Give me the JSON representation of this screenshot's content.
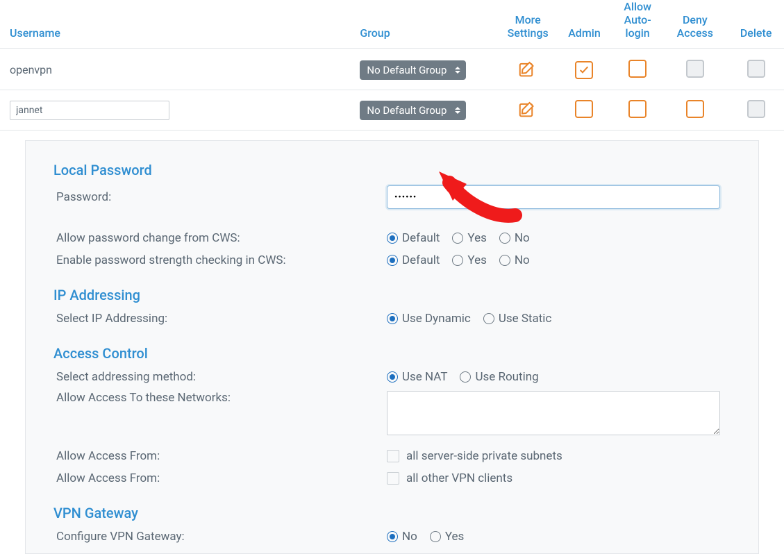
{
  "table": {
    "headers": {
      "username": "Username",
      "group": "Group",
      "more": "More Settings",
      "admin": "Admin",
      "autologin": "Allow Auto-login",
      "deny": "Deny Access",
      "delete": "Delete"
    },
    "rows": [
      {
        "username": "openvpn",
        "group": "No Default Group",
        "editable": false,
        "admin": true
      },
      {
        "username": "jannet",
        "group": "No Default Group",
        "editable": true,
        "admin": false
      }
    ]
  },
  "panel": {
    "local_password": {
      "title": "Local Password",
      "password_label": "Password:",
      "password_value": "••••••",
      "allow_change_label": "Allow password change from CWS:",
      "strength_label": "Enable password strength checking in CWS:",
      "opts": {
        "default": "Default",
        "yes": "Yes",
        "no": "No"
      }
    },
    "ip": {
      "title": "IP Addressing",
      "select_label": "Select IP Addressing:",
      "dynamic": "Use Dynamic",
      "static": "Use Static"
    },
    "access": {
      "title": "Access Control",
      "method_label": "Select addressing method:",
      "nat": "Use NAT",
      "routing": "Use Routing",
      "networks_label": "Allow Access To these Networks:",
      "from_label": "Allow Access From:",
      "chk1": "all server-side private subnets",
      "chk2": "all other VPN clients"
    },
    "gateway": {
      "title": "VPN Gateway",
      "configure_label": "Configure VPN Gateway:",
      "no": "No",
      "yes": "Yes"
    }
  }
}
